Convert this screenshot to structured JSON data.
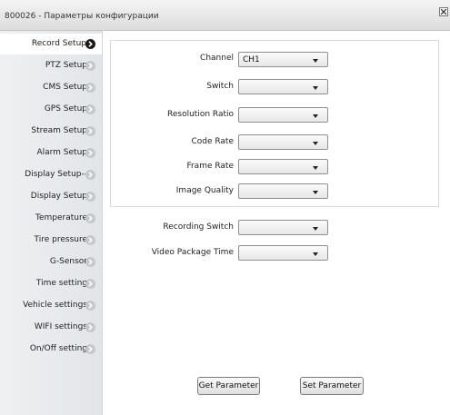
{
  "window": {
    "title": "800026 - Параметры конфигурации",
    "close_icon": "close-icon"
  },
  "sidebar": {
    "items": [
      {
        "label": "Record Setup",
        "active": true
      },
      {
        "label": "PTZ Setup"
      },
      {
        "label": "CMS Setup"
      },
      {
        "label": "GPS Setup"
      },
      {
        "label": "Stream Setup"
      },
      {
        "label": "Alarm Setup"
      },
      {
        "label": "Display Setup--"
      },
      {
        "label": "Display Setup"
      },
      {
        "label": "Temperature"
      },
      {
        "label": "Tire pressure"
      },
      {
        "label": "G-Sensor"
      },
      {
        "label": "Time setting"
      },
      {
        "label": "Vehicle settings"
      },
      {
        "label": "WIFI settings"
      },
      {
        "label": "On/Off setting"
      }
    ]
  },
  "record": {
    "channel": {
      "label": "Channel",
      "value": "CH1"
    },
    "switch": {
      "label": "Switch",
      "value": ""
    },
    "resolution": {
      "label": "Resolution Ratio",
      "value": ""
    },
    "code_rate": {
      "label": "Code Rate",
      "value": ""
    },
    "frame_rate": {
      "label": "Frame Rate",
      "value": ""
    },
    "image_quality": {
      "label": "Image Quality",
      "value": ""
    },
    "recording_switch": {
      "label": "Recording Switch",
      "value": ""
    },
    "video_package_time": {
      "label": "Video Package Time",
      "value": ""
    }
  },
  "actions": {
    "get": "Get Parameter",
    "set": "Set Parameter"
  }
}
